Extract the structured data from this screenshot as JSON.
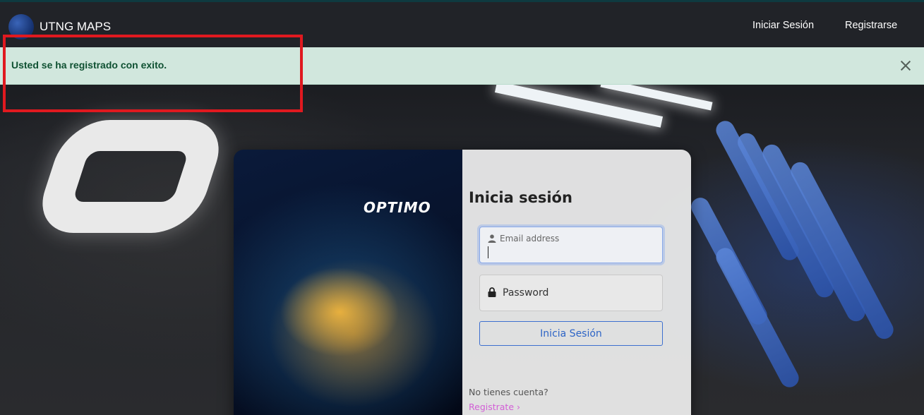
{
  "navbar": {
    "brand": "UTNG MAPS",
    "links": [
      "Iniciar Sesión",
      "Registrarse"
    ]
  },
  "alert": {
    "message": "Usted se ha registrado con exito."
  },
  "card": {
    "image_logo": "OPTIMO",
    "title": "Inicia sesión",
    "email_label": "Email address",
    "password_label": "Password",
    "submit_label": "Inicia Sesión",
    "no_account": "No tienes cuenta?",
    "register_link": "Registrate"
  },
  "colors": {
    "alert_bg": "#d1e7dd",
    "alert_text": "#0f5132",
    "navbar_bg": "#212328",
    "button_accent": "#2d64c6",
    "link_accent": "#d25fd6",
    "highlight": "#e0191f"
  }
}
